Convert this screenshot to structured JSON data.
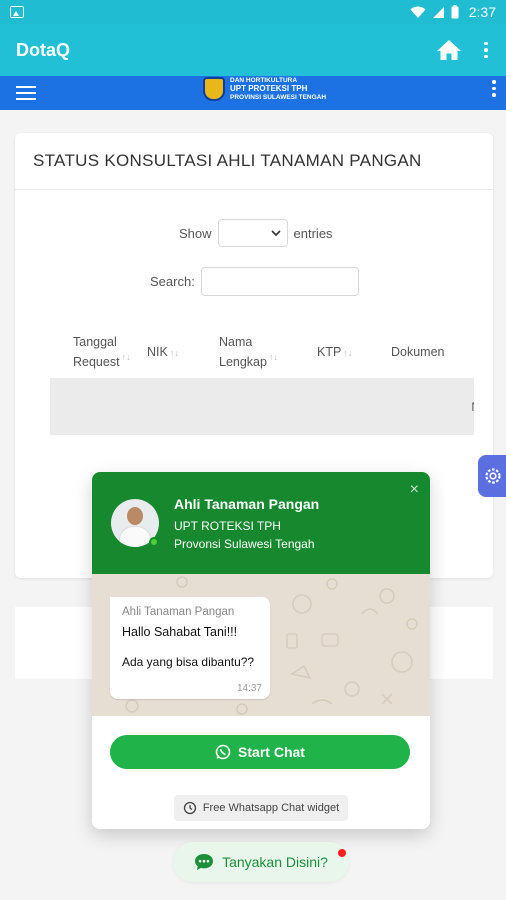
{
  "status_bar": {
    "time": "2:37"
  },
  "app_bar": {
    "title": "DotaQ"
  },
  "site_header": {
    "logo_line1": "DAN HORTIKULTURA",
    "logo_line2": "UPT PROTEKSI TPH",
    "logo_line3": "PROVINSI SULAWESI TENGAH"
  },
  "card": {
    "title": "STATUS KONSULTASI AHLI TANAMAN PANGAN",
    "show_label": "Show",
    "entries_label": "entries",
    "search_label": "Search:",
    "search_value": "",
    "columns": [
      {
        "line1": "Tanggal",
        "line2": "Request"
      },
      {
        "line1": "NIK",
        "line2": ""
      },
      {
        "line1": "Nama",
        "line2": "Lengkap"
      },
      {
        "line1": "KTP",
        "line2": ""
      },
      {
        "line1": "Dokumen",
        "line2": ""
      }
    ],
    "empty_row_text": "N"
  },
  "chat_widget": {
    "agent_name": "Ahli Tanaman Pangan",
    "org": "UPT ROTEKSI TPH",
    "location": "Provonsi Sulawesi Tengah",
    "close_label": "×",
    "bubble_sender": "Ahli Tanaman Pangan",
    "bubble_msg1": "Hallo Sahabat Tani!!!",
    "bubble_msg2": "Ada yang bisa dibantu??",
    "bubble_time": "14:37",
    "start_chat_label": "Start Chat",
    "free_widget_label": "Free Whatsapp Chat widget"
  },
  "ask_button": {
    "label": "Tanyakan Disini?"
  },
  "colors": {
    "app_bar": "#22c0d6",
    "site_header": "#1c72e3",
    "widget_header": "#16892f",
    "start_chat": "#20b34a",
    "gear_tab": "#5b6fe0"
  },
  "icons": [
    "image-icon",
    "wifi-icon",
    "signal-icon",
    "battery-icon",
    "home-icon",
    "more-vert-icon",
    "menu-icon",
    "gear-icon",
    "whatsapp-icon",
    "chat-icon",
    "history-icon",
    "close-icon"
  ]
}
